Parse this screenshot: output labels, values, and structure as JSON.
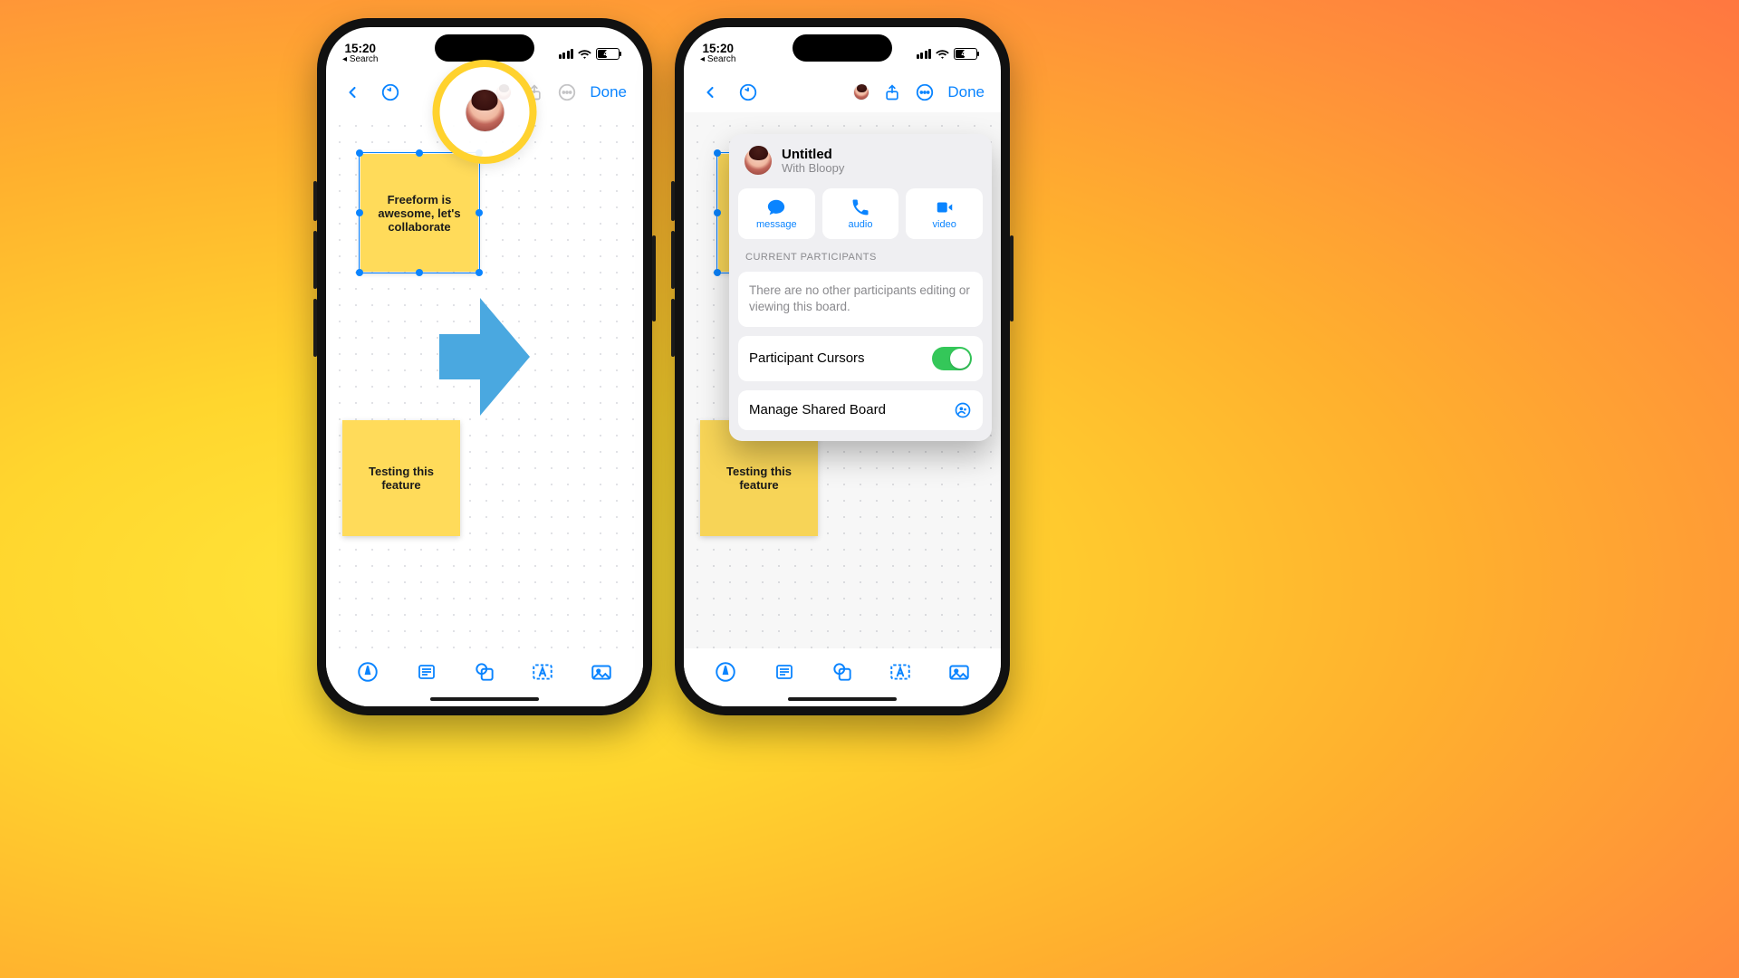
{
  "statusbar": {
    "time": "15:20",
    "back_app": "Search",
    "battery_text": "43"
  },
  "toolbar": {
    "done_label": "Done"
  },
  "board": {
    "note1_text": "Freeform is awesome, let's collaborate",
    "note2_text": "Testing this feature"
  },
  "share_sheet": {
    "title": "Untitled",
    "subtitle": "With Bloopy",
    "contact_actions": {
      "message": "message",
      "audio": "audio",
      "video": "video"
    },
    "participants_heading": "CURRENT PARTICIPANTS",
    "participants_empty": "There are no other participants editing or viewing this board.",
    "cursors_label": "Participant Cursors",
    "cursors_on": true,
    "manage_label": "Manage Shared Board"
  }
}
